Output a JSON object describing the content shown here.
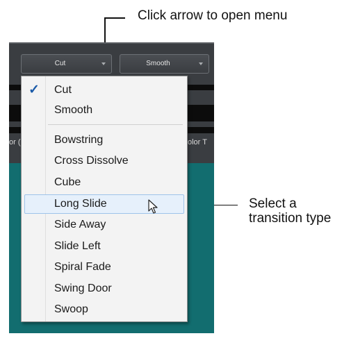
{
  "annotations": {
    "top_callout": "Click arrow to open menu",
    "side_callout_line1": "Select a",
    "side_callout_line2": "transition type"
  },
  "panel": {
    "left_fragment": "or (",
    "right_fragment": "olor T"
  },
  "toolbar": {
    "left_dropdown_value": "Cut",
    "right_dropdown_value": "Smooth"
  },
  "menu": {
    "checked_item": "Cut",
    "group1": [
      "Cut",
      "Smooth"
    ],
    "group2": [
      "Bowstring",
      "Cross Dissolve",
      "Cube",
      "Long Slide",
      "Side Away",
      "Slide Left",
      "Spiral Fade",
      "Swing Door",
      "Swoop"
    ],
    "hovered_item": "Long Slide"
  },
  "colors": {
    "teal": "#126d6f",
    "panel": "#3a3d41",
    "menu_bg": "#f3f3f3",
    "hover_bg": "#e6f0fb",
    "check": "#1a5aa8"
  },
  "icons": [
    "checkmark-icon",
    "chevron-down-icon",
    "mouse-pointer-icon"
  ]
}
